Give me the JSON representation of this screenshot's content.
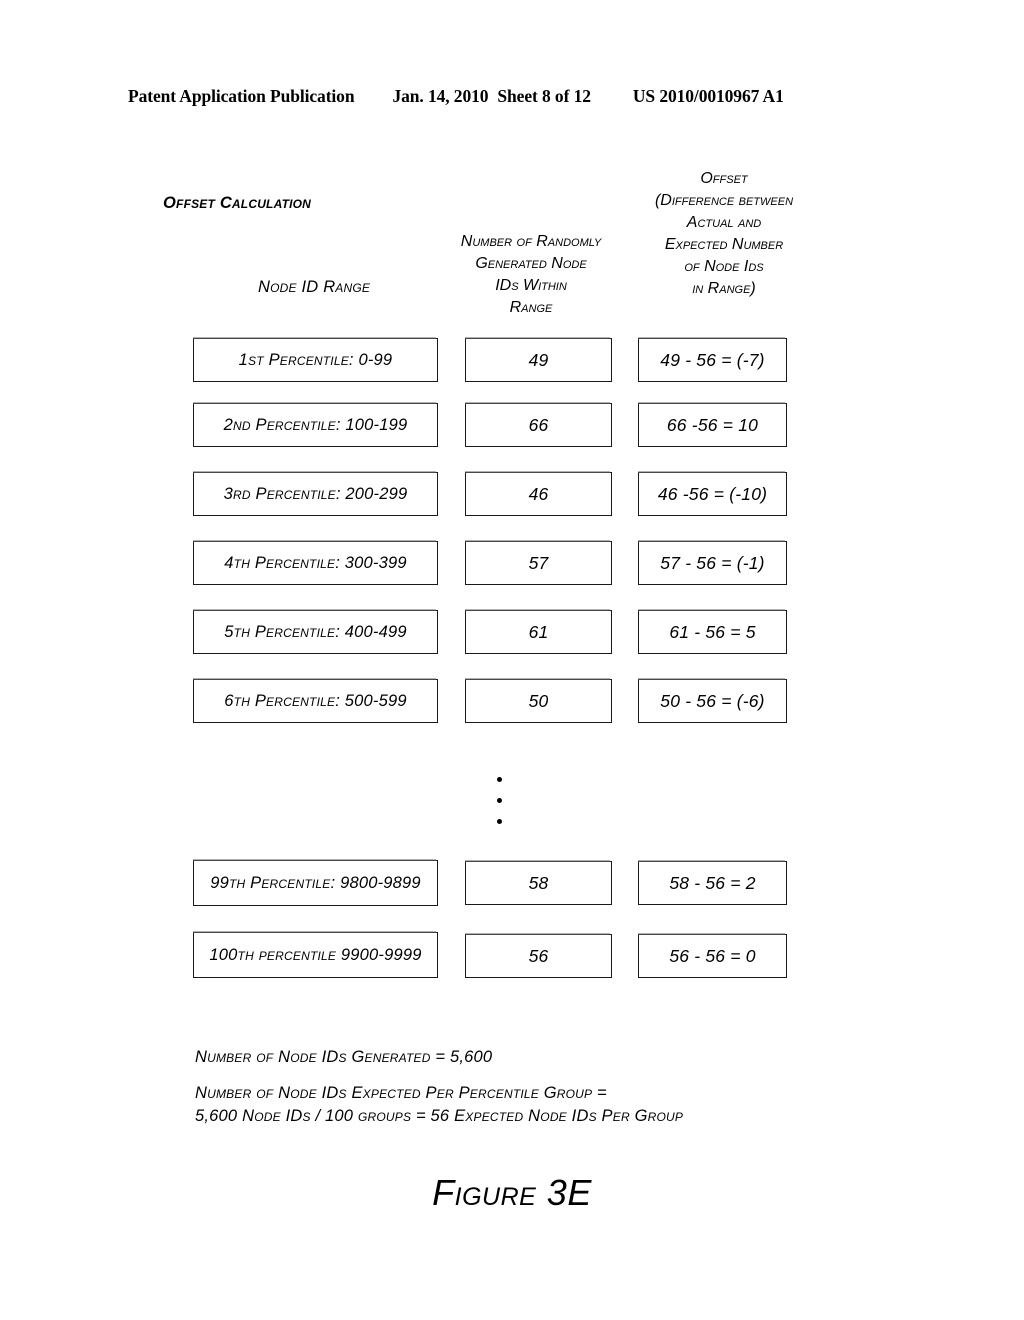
{
  "page_header": {
    "publication": "Patent Application Publication",
    "date": "Jan. 14, 2010",
    "sheet": "Sheet 8 of 12",
    "publication_number": "US 2010/0010967 A1"
  },
  "figure": {
    "caption": "Figure 3E",
    "title": "Offset Calculation",
    "columns": {
      "range_label": "Node ID Range",
      "count_header_lines": [
        "Number of Randomly",
        "Generated Node",
        "IDs Within",
        "Range"
      ],
      "offset_header_lines": [
        "Offset",
        "(Difference between",
        "Actual and",
        "Expected Number",
        "of Node Ids",
        "in Range)"
      ]
    },
    "ellipsis": "vertical-ellipsis",
    "rows": [
      {
        "range": "1st Percentile: 0-99",
        "count": "49",
        "offset": "49 - 56 = (-7)"
      },
      {
        "range": "2nd Percentile: 100-199",
        "count": "66",
        "offset": "66 -56 = 10"
      },
      {
        "range": "3rd Percentile: 200-299",
        "count": "46",
        "offset": "46 -56 = (-10)"
      },
      {
        "range": "4th Percentile: 300-399",
        "count": "57",
        "offset": "57 - 56 = (-1)"
      },
      {
        "range": "5th Percentile: 400-499",
        "count": "61",
        "offset": "61 - 56 = 5"
      },
      {
        "range": "6th Percentile: 500-599",
        "count": "50",
        "offset": "50 - 56 = (-6)"
      }
    ],
    "rows_tail": [
      {
        "range": "99th Percentile: 9800-9899",
        "count": "58",
        "offset": "58 - 56 = 2"
      },
      {
        "range": "100th percentile 9900-9999",
        "count": "56",
        "offset": "56 - 56 = 0"
      }
    ],
    "notes": {
      "generated": "Number of Node IDs Generated = 5,600",
      "expected_line1": "Number of Node IDs Expected Per Percentile Group =",
      "expected_line2": "5,600 Node IDs / 100 groups = 56 Expected Node IDs Per Group"
    }
  },
  "chart_data": {
    "type": "table",
    "title": "Offset Calculation",
    "columns": [
      "Node ID Range",
      "Number of Randomly Generated Node IDs Within Range",
      "Offset (Difference between Actual and Expected Number of Node Ids in Range)"
    ],
    "categories": [
      "1st Percentile: 0-99",
      "2nd Percentile: 100-199",
      "3rd Percentile: 200-299",
      "4th Percentile: 300-399",
      "5th Percentile: 400-499",
      "6th Percentile: 500-599",
      "99th Percentile: 9800-9899",
      "100th percentile 9900-9999"
    ],
    "series": [
      {
        "name": "Number of Randomly Generated Node IDs Within Range",
        "values": [
          49,
          66,
          46,
          57,
          61,
          50,
          58,
          56
        ]
      },
      {
        "name": "Offset (Actual minus Expected)",
        "values": [
          -7,
          10,
          -10,
          -1,
          5,
          -6,
          2,
          0
        ]
      }
    ],
    "expected_per_group": 56,
    "total_generated": 5600,
    "group_count": 100
  }
}
